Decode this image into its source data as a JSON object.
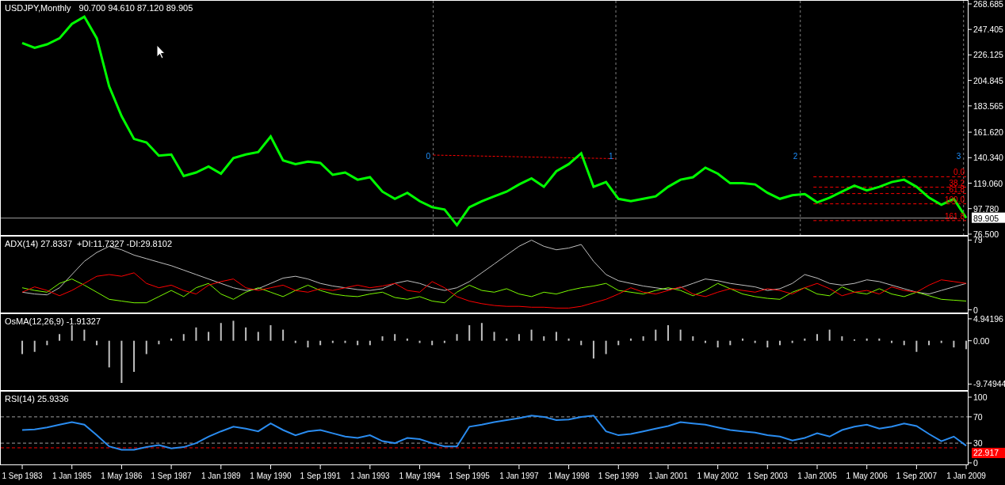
{
  "chart": {
    "symbol": "USDJPY,Monthly",
    "ohlc": "90.700 94.610 87.120 89.905",
    "chart_data": {
      "type": "line",
      "xlim": [
        "1983-02-04",
        "2009-01-16"
      ],
      "ylim": [
        75.8,
        271.3
      ],
      "x": [
        "1983-09-01",
        "1984-01-01",
        "1984-05-01",
        "1984-09-01",
        "1985-01-01",
        "1985-05-01",
        "1985-09-01",
        "1986-01-01",
        "1986-05-01",
        "1986-09-01",
        "1987-01-01",
        "1987-05-01",
        "1987-09-01",
        "1988-01-01",
        "1988-05-01",
        "1988-09-01",
        "1989-01-01",
        "1989-05-01",
        "1989-09-01",
        "1990-01-01",
        "1990-05-01",
        "1990-09-01",
        "1991-01-01",
        "1991-05-01",
        "1991-09-01",
        "1992-01-01",
        "1992-05-01",
        "1992-09-01",
        "1993-01-01",
        "1993-05-01",
        "1993-09-01",
        "1994-01-01",
        "1994-05-01",
        "1994-09-01",
        "1995-01-01",
        "1995-05-01",
        "1995-09-01",
        "1996-01-01",
        "1996-05-01",
        "1996-09-01",
        "1997-01-01",
        "1997-05-01",
        "1997-09-01",
        "1998-01-01",
        "1998-05-01",
        "1998-09-01",
        "1999-01-01",
        "1999-05-01",
        "1999-09-01",
        "2000-01-01",
        "2000-05-01",
        "2000-09-01",
        "2001-01-01",
        "2001-05-01",
        "2001-09-01",
        "2002-01-01",
        "2002-05-01",
        "2002-09-01",
        "2003-01-01",
        "2003-05-01",
        "2003-09-01",
        "2004-01-01",
        "2004-05-01",
        "2004-09-01",
        "2005-01-01",
        "2005-05-01",
        "2005-09-01",
        "2006-01-01",
        "2006-05-01",
        "2006-09-01",
        "2007-01-01",
        "2007-05-01",
        "2007-09-01",
        "2008-01-01",
        "2008-05-01",
        "2008-09-01",
        "2009-01-01"
      ],
      "series": [
        {
          "color": "#00ff00",
          "values": [
            236,
            232,
            235,
            240,
            252,
            258,
            240,
            200,
            175,
            156,
            153,
            142,
            143,
            125,
            128,
            133,
            127,
            140,
            143,
            145,
            158,
            138,
            135,
            137,
            136,
            126,
            128,
            122,
            124,
            112,
            106,
            111,
            104,
            99,
            97,
            84,
            99,
            104,
            108,
            112,
            118,
            123,
            116,
            129,
            135,
            144,
            116,
            120,
            106,
            104,
            106,
            108,
            116,
            122,
            124,
            132,
            127,
            119,
            119,
            118,
            111,
            106,
            109,
            110,
            103,
            107,
            112,
            117,
            113,
            116,
            120,
            122,
            116,
            107,
            101,
            106,
            90
          ]
        }
      ],
      "yticks": [
        {
          "value": 268.685,
          "label": "268.685"
        },
        {
          "value": 247.405,
          "label": "247.405"
        },
        {
          "value": 226.125,
          "label": "226.125"
        },
        {
          "value": 204.845,
          "label": "204.845"
        },
        {
          "value": 183.565,
          "label": "183.565"
        },
        {
          "value": 161.62,
          "label": "161.620"
        },
        {
          "value": 140.34,
          "label": "140.340"
        },
        {
          "value": 119.06,
          "label": "119.060"
        },
        {
          "value": 97.78,
          "label": "97.780"
        },
        {
          "value": 76.5,
          "label": "76.500"
        }
      ],
      "ref_lines": [
        {
          "axis": "y",
          "value": 124.4
        },
        {
          "axis": "y",
          "value": 115.7
        },
        {
          "axis": "y",
          "value": 110.4
        },
        {
          "axis": "y",
          "value": 101.8
        },
        {
          "axis": "y",
          "value": 87.8
        },
        {
          "axis": "y",
          "value": 89.905,
          "label": "89.905"
        }
      ],
      "annotations": [
        "0.0",
        "38.2",
        "61.8",
        "100.0",
        "161.8"
      ]
    },
    "time_zones": [
      "0",
      "1",
      "2",
      "3"
    ]
  },
  "indicators": [
    {
      "kind": "adx",
      "label": "ADX(14) 27.8337  +DI:11.7327 -DI:29.8102",
      "chart_data": {
        "type": "line",
        "xlim": [
          "1983-02-04",
          "2009-01-16"
        ],
        "ylim": [
          -3,
          83
        ],
        "x": [
          "1983-09-01",
          "1984-01-01",
          "1984-05-01",
          "1984-09-01",
          "1985-01-01",
          "1985-05-01",
          "1985-09-01",
          "1986-01-01",
          "1986-05-01",
          "1986-09-01",
          "1987-01-01",
          "1987-05-01",
          "1987-09-01",
          "1988-01-01",
          "1988-05-01",
          "1988-09-01",
          "1989-01-01",
          "1989-05-01",
          "1989-09-01",
          "1990-01-01",
          "1990-05-01",
          "1990-09-01",
          "1991-01-01",
          "1991-05-01",
          "1991-09-01",
          "1992-01-01",
          "1992-05-01",
          "1992-09-01",
          "1993-01-01",
          "1993-05-01",
          "1993-09-01",
          "1994-01-01",
          "1994-05-01",
          "1994-09-01",
          "1995-01-01",
          "1995-05-01",
          "1995-09-01",
          "1996-01-01",
          "1996-05-01",
          "1996-09-01",
          "1997-01-01",
          "1997-05-01",
          "1997-09-01",
          "1998-01-01",
          "1998-05-01",
          "1998-09-01",
          "1999-01-01",
          "1999-05-01",
          "1999-09-01",
          "2000-01-01",
          "2000-05-01",
          "2000-09-01",
          "2001-01-01",
          "2001-05-01",
          "2001-09-01",
          "2002-01-01",
          "2002-05-01",
          "2002-09-01",
          "2003-01-01",
          "2003-05-01",
          "2003-09-01",
          "2004-01-01",
          "2004-05-01",
          "2004-09-01",
          "2005-01-01",
          "2005-05-01",
          "2005-09-01",
          "2006-01-01",
          "2006-05-01",
          "2006-09-01",
          "2007-01-01",
          "2007-05-01",
          "2007-09-01",
          "2008-01-01",
          "2008-05-01",
          "2008-09-01",
          "2009-01-01"
        ],
        "series": [
          {
            "color": "#c0c0c0",
            "values": [
              20,
              18,
              17,
              25,
              40,
              55,
              65,
              72,
              68,
              62,
              58,
              54,
              50,
              45,
              40,
              35,
              30,
              25,
              22,
              24,
              30,
              36,
              38,
              35,
              30,
              27,
              25,
              23,
              22,
              24,
              30,
              33,
              30,
              25,
              22,
              25,
              32,
              42,
              52,
              62,
              72,
              79,
              72,
              68,
              70,
              74,
              55,
              40,
              33,
              30,
              27,
              25,
              23,
              25,
              30,
              35,
              33,
              30,
              28,
              26,
              22,
              24,
              30,
              40,
              36,
              30,
              28,
              30,
              34,
              32,
              28,
              24,
              20,
              18,
              22,
              26,
              30
            ]
          },
          {
            "color": "#7cfc00",
            "values": [
              25,
              22,
              20,
              30,
              35,
              28,
              20,
              12,
              10,
              8,
              8,
              15,
              22,
              15,
              25,
              30,
              18,
              12,
              20,
              25,
              20,
              15,
              22,
              28,
              22,
              18,
              16,
              15,
              18,
              20,
              14,
              12,
              15,
              10,
              8,
              20,
              28,
              22,
              20,
              24,
              18,
              15,
              20,
              18,
              22,
              25,
              27,
              30,
              22,
              20,
              18,
              22,
              25,
              22,
              16,
              22,
              30,
              24,
              18,
              15,
              13,
              12,
              20,
              25,
              18,
              16,
              26,
              20,
              18,
              24,
              18,
              15,
              20,
              16,
              12,
              11,
              10
            ]
          },
          {
            "color": "#ff0000",
            "values": [
              20,
              26,
              22,
              16,
              22,
              30,
              38,
              40,
              38,
              42,
              30,
              25,
              28,
              22,
              18,
              28,
              32,
              35,
              25,
              22,
              25,
              28,
              22,
              20,
              24,
              22,
              25,
              28,
              25,
              27,
              30,
              22,
              20,
              32,
              25,
              15,
              10,
              7,
              5,
              4,
              4,
              3,
              3,
              2,
              2,
              4,
              8,
              12,
              18,
              25,
              20,
              18,
              22,
              26,
              18,
              15,
              20,
              24,
              22,
              20,
              24,
              22,
              18,
              25,
              30,
              24,
              16,
              20,
              22,
              18,
              26,
              22,
              20,
              28,
              34,
              32,
              30
            ]
          }
        ],
        "yticks": [
          79,
          0
        ]
      }
    },
    {
      "kind": "osma",
      "label": "OsMA(12,26,9) -1.91327",
      "chart_data": {
        "type": "bar",
        "xlim": [
          "1983-02-04",
          "2009-01-16"
        ],
        "ylim": [
          -11.1,
          6.0
        ],
        "x": [
          "1983-09-01",
          "1984-01-01",
          "1984-05-01",
          "1984-09-01",
          "1985-01-01",
          "1985-05-01",
          "1985-09-01",
          "1986-01-01",
          "1986-05-01",
          "1986-09-01",
          "1987-01-01",
          "1987-05-01",
          "1987-09-01",
          "1988-01-01",
          "1988-05-01",
          "1988-09-01",
          "1989-01-01",
          "1989-05-01",
          "1989-09-01",
          "1990-01-01",
          "1990-05-01",
          "1990-09-01",
          "1991-01-01",
          "1991-05-01",
          "1991-09-01",
          "1992-01-01",
          "1992-05-01",
          "1992-09-01",
          "1993-01-01",
          "1993-05-01",
          "1993-09-01",
          "1994-01-01",
          "1994-05-01",
          "1994-09-01",
          "1995-01-01",
          "1995-05-01",
          "1995-09-01",
          "1996-01-01",
          "1996-05-01",
          "1996-09-01",
          "1997-01-01",
          "1997-05-01",
          "1997-09-01",
          "1998-01-01",
          "1998-05-01",
          "1998-09-01",
          "1999-01-01",
          "1999-05-01",
          "1999-09-01",
          "2000-01-01",
          "2000-05-01",
          "2000-09-01",
          "2001-01-01",
          "2001-05-01",
          "2001-09-01",
          "2002-01-01",
          "2002-05-01",
          "2002-09-01",
          "2003-01-01",
          "2003-05-01",
          "2003-09-01",
          "2004-01-01",
          "2004-05-01",
          "2004-09-01",
          "2005-01-01",
          "2005-05-01",
          "2005-09-01",
          "2006-01-01",
          "2006-05-01",
          "2006-09-01",
          "2007-01-01",
          "2007-05-01",
          "2007-09-01",
          "2008-01-01",
          "2008-05-01",
          "2008-09-01",
          "2009-01-01"
        ],
        "series": [
          {
            "color": "#c0c0c0",
            "values": [
              -3,
              -2.5,
              -1,
              1.5,
              3.5,
              2.5,
              -1,
              -6,
              -9.5,
              -7,
              -3,
              -0.8,
              0.5,
              1.5,
              3,
              2,
              4,
              4.5,
              3,
              2,
              3.5,
              2.5,
              -0.5,
              -1.5,
              -1,
              -0.5,
              -0.5,
              -1,
              -1,
              1,
              1.5,
              0.5,
              -0.5,
              -1,
              -0.5,
              1.5,
              3.5,
              4,
              2,
              0.5,
              1.5,
              2.5,
              1,
              2,
              0.5,
              -1,
              -4,
              -3,
              -1,
              0.5,
              1,
              2.5,
              3.5,
              2.5,
              1,
              -0.5,
              -1.5,
              -1,
              0.5,
              -0.5,
              -1.5,
              -1,
              -0.5,
              0.5,
              1.5,
              2.5,
              1,
              0.3,
              0.5,
              0.5,
              -0.5,
              -1,
              -2.5,
              -1,
              -0.5,
              -1.5,
              -1.9
            ]
          }
        ],
        "yticks": [
          {
            "value": 4.94196,
            "label": "4.94196"
          },
          {
            "value": 0,
            "label": "0.00"
          },
          {
            "value": -9.74944,
            "label": "-9.74944"
          }
        ]
      }
    },
    {
      "kind": "rsi",
      "label": "RSI(14) 25.9336",
      "chart_data": {
        "type": "line",
        "xlim": [
          "1983-02-04",
          "2009-01-16"
        ],
        "ylim": [
          -2.4,
          108.4
        ],
        "x": [
          "1983-09-01",
          "1984-01-01",
          "1984-05-01",
          "1984-09-01",
          "1985-01-01",
          "1985-05-01",
          "1985-09-01",
          "1986-01-01",
          "1986-05-01",
          "1986-09-01",
          "1987-01-01",
          "1987-05-01",
          "1987-09-01",
          "1988-01-01",
          "1988-05-01",
          "1988-09-01",
          "1989-01-01",
          "1989-05-01",
          "1989-09-01",
          "1990-01-01",
          "1990-05-01",
          "1990-09-01",
          "1991-01-01",
          "1991-05-01",
          "1991-09-01",
          "1992-01-01",
          "1992-05-01",
          "1992-09-01",
          "1993-01-01",
          "1993-05-01",
          "1993-09-01",
          "1994-01-01",
          "1994-05-01",
          "1994-09-01",
          "1995-01-01",
          "1995-05-01",
          "1995-09-01",
          "1996-01-01",
          "1996-05-01",
          "1996-09-01",
          "1997-01-01",
          "1997-05-01",
          "1997-09-01",
          "1998-01-01",
          "1998-05-01",
          "1998-09-01",
          "1999-01-01",
          "1999-05-01",
          "1999-09-01",
          "2000-01-01",
          "2000-05-01",
          "2000-09-01",
          "2001-01-01",
          "2001-05-01",
          "2001-09-01",
          "2002-01-01",
          "2002-05-01",
          "2002-09-01",
          "2003-01-01",
          "2003-05-01",
          "2003-09-01",
          "2004-01-01",
          "2004-05-01",
          "2004-09-01",
          "2005-01-01",
          "2005-05-01",
          "2005-09-01",
          "2006-01-01",
          "2006-05-01",
          "2006-09-01",
          "2007-01-01",
          "2007-05-01",
          "2007-09-01",
          "2008-01-01",
          "2008-05-01",
          "2008-09-01",
          "2009-01-01"
        ],
        "series": [
          {
            "color": "#2a8cf0",
            "values": [
              50,
              51,
              54,
              58,
              62,
              58,
              42,
              25,
              20,
              20,
              24,
              27,
              22,
              24,
              30,
              40,
              48,
              55,
              52,
              48,
              60,
              50,
              42,
              48,
              50,
              45,
              40,
              38,
              42,
              33,
              30,
              38,
              36,
              30,
              25,
              25,
              55,
              58,
              62,
              65,
              68,
              72,
              70,
              65,
              66,
              70,
              72,
              48,
              42,
              44,
              48,
              52,
              56,
              62,
              60,
              58,
              54,
              50,
              48,
              46,
              42,
              40,
              34,
              38,
              45,
              40,
              50,
              55,
              58,
              52,
              55,
              60,
              56,
              44,
              33,
              40,
              26
            ]
          }
        ],
        "yticks": [
          100,
          70,
          30,
          0
        ],
        "xticks": [
          {
            "value": "1983-09-01",
            "label": "1 Sep 1983"
          },
          {
            "value": "1985-01-01",
            "label": "1 Jan 1985"
          },
          {
            "value": "1986-05-01",
            "label": "1 May 1986"
          },
          {
            "value": "1987-09-01",
            "label": "1 Sep 1987"
          },
          {
            "value": "1989-01-01",
            "label": "1 Jan 1989"
          },
          {
            "value": "1990-05-01",
            "label": "1 May 1990"
          },
          {
            "value": "1991-09-01",
            "label": "1 Sep 1991"
          },
          {
            "value": "1993-01-01",
            "label": "1 Jan 1993"
          },
          {
            "value": "1994-05-01",
            "label": "1 May 1994"
          },
          {
            "value": "1995-09-01",
            "label": "1 Sep 1995"
          },
          {
            "value": "1997-01-01",
            "label": "1 Jan 1997"
          },
          {
            "value": "1998-05-01",
            "label": "1 May 1998"
          },
          {
            "value": "1999-09-01",
            "label": "1 Sep 1999"
          },
          {
            "value": "2001-01-01",
            "label": "1 Jan 2001"
          },
          {
            "value": "2002-05-01",
            "label": "1 May 2002"
          },
          {
            "value": "2003-09-01",
            "label": "1 Sep 2003"
          },
          {
            "value": "2005-01-01",
            "label": "1 Jan 2005"
          },
          {
            "value": "2006-05-01",
            "label": "1 May 2006"
          },
          {
            "value": "2007-09-01",
            "label": "1 Sep 2007"
          },
          {
            "value": "2009-01-01",
            "label": "1 Jan 2009"
          }
        ],
        "ref_lines": [
          {
            "axis": "y",
            "value": 70
          },
          {
            "axis": "y",
            "value": 30
          },
          {
            "axis": "y",
            "value": 22.917,
            "label": "22.917"
          }
        ]
      }
    }
  ]
}
